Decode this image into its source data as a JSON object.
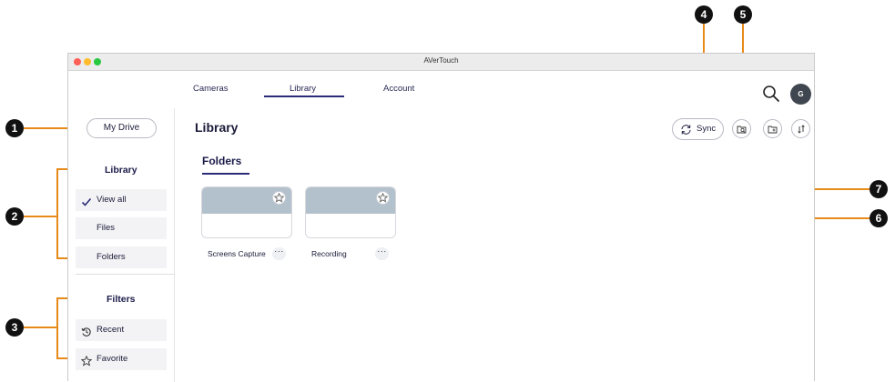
{
  "window": {
    "title": "AVerTouch"
  },
  "tabs": [
    {
      "label": "Cameras"
    },
    {
      "label": "Library"
    },
    {
      "label": "Account"
    }
  ],
  "header": {
    "avatar_initial": "G",
    "search_icon": "search-icon"
  },
  "sidebar": {
    "my_drive_label": "My Drive",
    "library_heading": "Library",
    "library_items": [
      {
        "label": "View all",
        "icon": "check-icon",
        "selected": true
      },
      {
        "label": "Files"
      },
      {
        "label": "Folders"
      }
    ],
    "filters_heading": "Filters",
    "filter_items": [
      {
        "label": "Recent",
        "icon": "history-icon"
      },
      {
        "label": "Favorite",
        "icon": "star-icon"
      }
    ]
  },
  "main": {
    "title": "Library",
    "sync_label": "Sync",
    "folders_heading": "Folders",
    "folders": [
      {
        "name": "Screens Capture",
        "more": "···"
      },
      {
        "name": "Recording",
        "more": "···"
      }
    ]
  },
  "callouts": [
    "1",
    "2",
    "3",
    "4",
    "5",
    "6",
    "7"
  ],
  "colors": {
    "accent": "#2b2b7a",
    "callout_line": "#e88a1a",
    "folder_fill": "#b3c1cc"
  }
}
